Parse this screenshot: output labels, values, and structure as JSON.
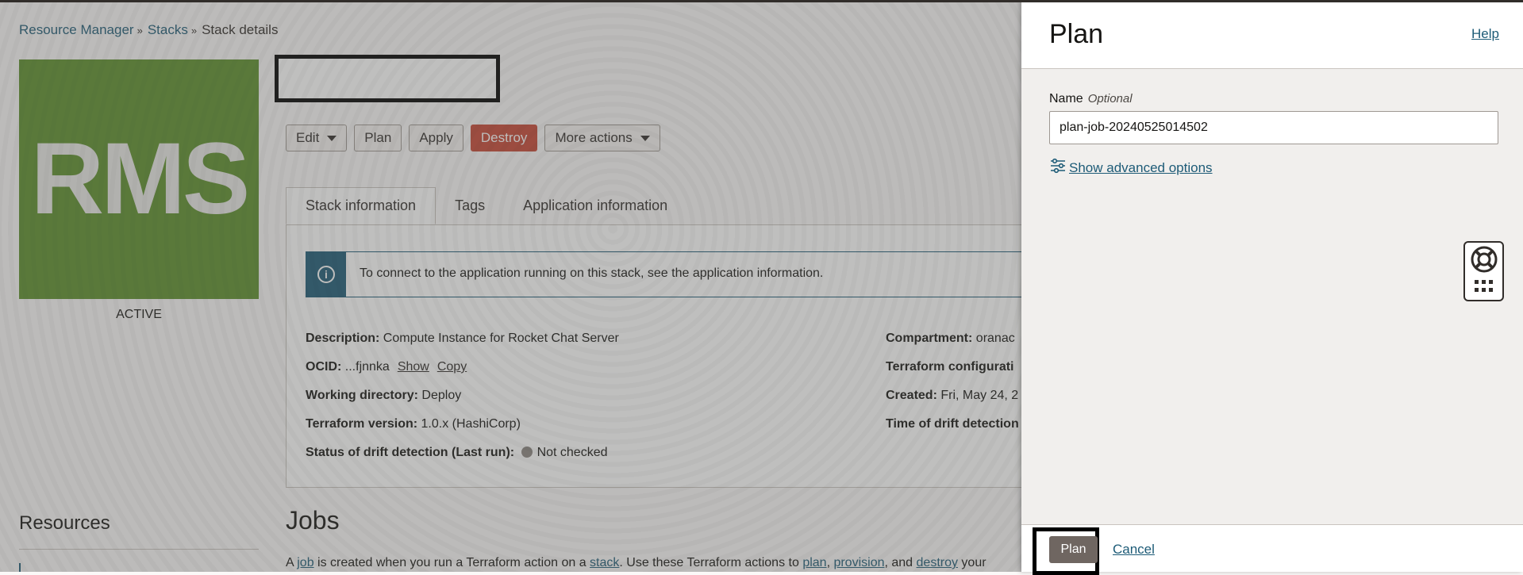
{
  "breadcrumb": {
    "items": [
      "Resource Manager",
      "Stacks"
    ],
    "current": "Stack details"
  },
  "logo": {
    "text": "RMS",
    "color": "#5d8f2b"
  },
  "stack": {
    "status": "ACTIVE"
  },
  "actions": {
    "edit": "Edit",
    "plan": "Plan",
    "apply": "Apply",
    "destroy": "Destroy",
    "more": "More actions"
  },
  "tabs": [
    "Stack information",
    "Tags",
    "Application information"
  ],
  "info_banner": {
    "text": "To connect to the application running on this stack, see the application information."
  },
  "details": {
    "description_label": "Description:",
    "description_value": "Compute Instance for Rocket Chat Server",
    "ocid_label": "OCID:",
    "ocid_value": "...fjnnka",
    "show_link": "Show",
    "copy_link": "Copy",
    "workdir_label": "Working directory:",
    "workdir_value": "Deploy",
    "tfver_label": "Terraform version:",
    "tfver_value": "1.0.x (HashiCorp)",
    "drift_label": "Status of drift detection (Last run):",
    "drift_value": "Not checked",
    "compartment_label": "Compartment:",
    "compartment_value": "oranac",
    "tfconfig_label": "Terraform configurati",
    "created_label": "Created:",
    "created_value": "Fri, May 24, 2",
    "drift_time_label": "Time of drift detection"
  },
  "resources": {
    "title": "Resources"
  },
  "jobs": {
    "title": "Jobs",
    "desc": {
      "t1": "A ",
      "l1": "job",
      "t2": " is created when you run a Terraform action on a ",
      "l2": "stack",
      "t3": ". Use these Terraform actions to ",
      "l3": "plan",
      "t4": ", ",
      "l4": "provision",
      "t5": ", and ",
      "l5": "destroy",
      "t6": " your"
    }
  },
  "drawer": {
    "title": "Plan",
    "help": "Help",
    "name_label": "Name",
    "optional": "Optional",
    "name_value": "plan-job-20240525014502",
    "advanced": "Show advanced options",
    "submit": "Plan",
    "cancel": "Cancel"
  },
  "colors": {
    "link": "#1d5b77",
    "destroy": "#c74634",
    "submit": "#6f6661"
  },
  "icons": {
    "info": "info-icon",
    "advanced": "sliders-icon",
    "help": "lifebuoy-icon",
    "apps": "grid-icon"
  }
}
